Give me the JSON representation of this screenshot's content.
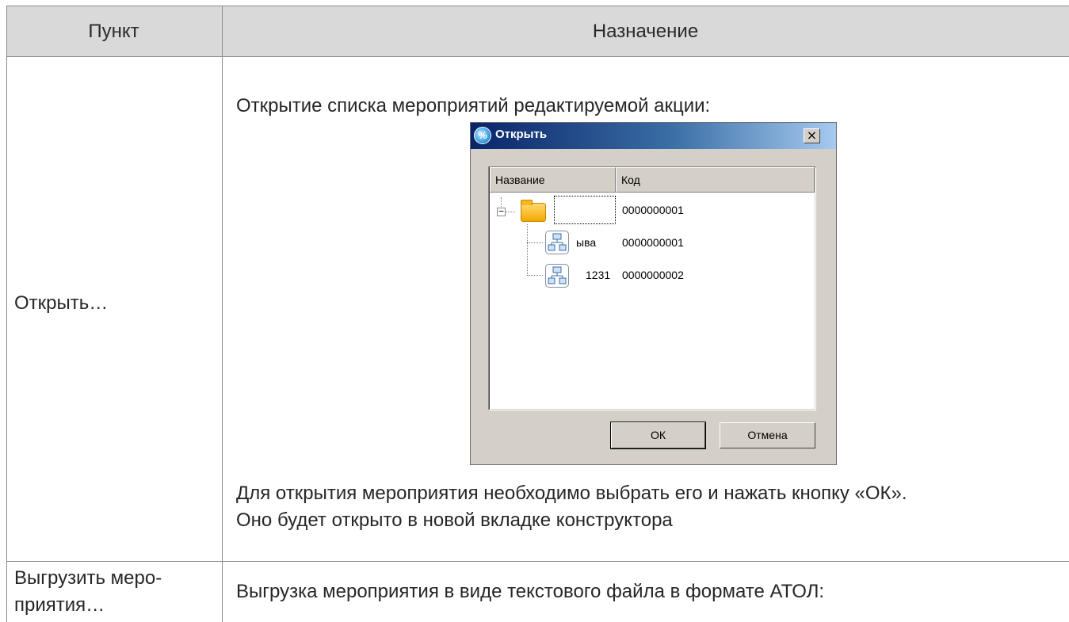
{
  "table": {
    "header": {
      "col1": "Пункт",
      "col2": "Назначение"
    },
    "rows": [
      {
        "item": "Открыть…",
        "description_intro": "Открытие списка мероприятий редактируемой акции:",
        "description_after_line1": "Для открытия мероприятия необходимо выбрать его и нажать кнопку «ОК».",
        "description_after_line2": "Оно будет открыто в новой вкладке конструктора"
      },
      {
        "item_line1": "Выгрузить меро-",
        "item_line2": "приятия…",
        "description_intro": "Выгрузка мероприятия в виде текстового файла в формате АТОЛ:"
      }
    ]
  },
  "dialog": {
    "title": "Открыть",
    "close_glyph": "×",
    "columns": {
      "name": "Название",
      "code": "Код"
    },
    "tree": [
      {
        "name": "",
        "code": "0000000001",
        "kind": "folder",
        "expanded": true
      },
      {
        "name": "ыва",
        "code": "0000000001",
        "kind": "event"
      },
      {
        "name": "1231",
        "code": "0000000002",
        "kind": "event"
      }
    ],
    "buttons": {
      "ok": "ОК",
      "cancel": "Отмена"
    }
  }
}
